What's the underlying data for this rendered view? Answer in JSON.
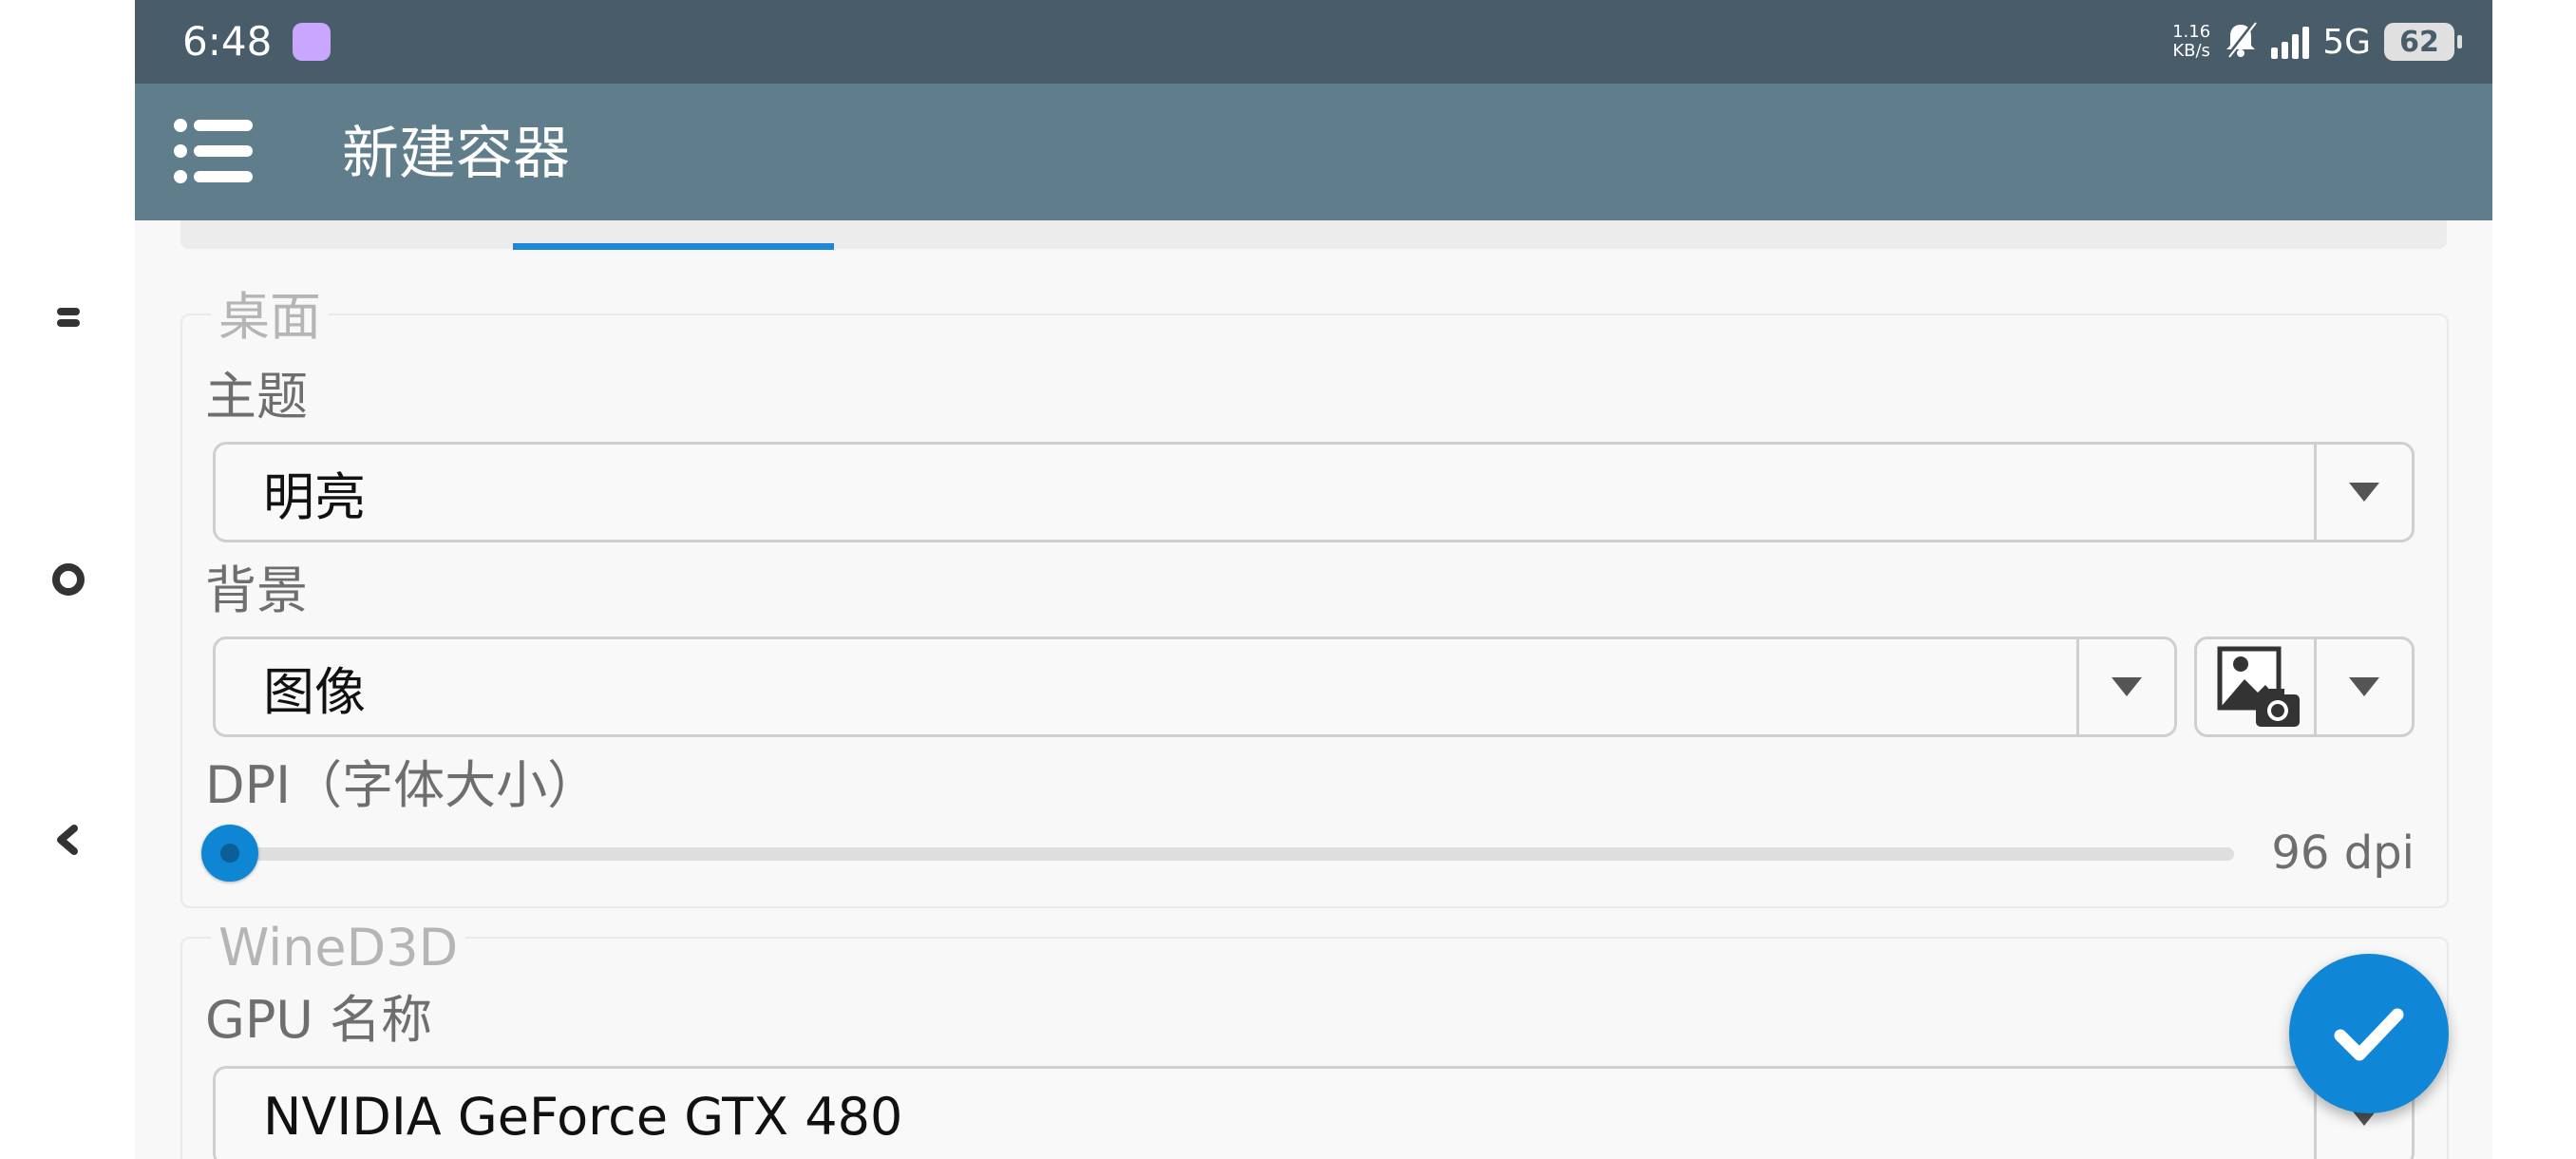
{
  "status_bar": {
    "time": "6:48",
    "net_speed_value": "1.16",
    "net_speed_unit": "KB/s",
    "network": "5G",
    "battery": "62"
  },
  "app_bar": {
    "title": "新建容器"
  },
  "desktop_section": {
    "legend": "桌面",
    "theme_label": "主题",
    "theme_value": "明亮",
    "background_label": "背景",
    "background_value": "图像",
    "dpi_label": "DPI（字体大小）",
    "dpi_value": "96 dpi",
    "dpi_level": 0.0
  },
  "wined3d_section": {
    "legend": "WineD3D",
    "gpu_label": "GPU 名称",
    "gpu_value": "NVIDIA GeForce GTX 480"
  },
  "colors": {
    "status_bar": "#485c69",
    "app_bar": "#607d8b",
    "accent": "#0f87d6",
    "background": "#f8f8f8"
  },
  "icons": {
    "menu": "menu-icon",
    "image": "image-camera-icon",
    "confirm": "check-icon"
  }
}
